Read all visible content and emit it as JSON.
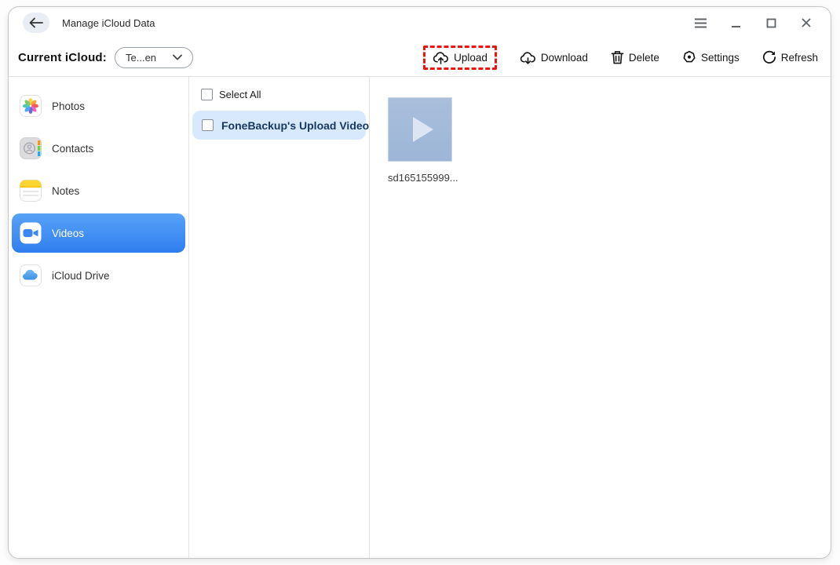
{
  "titlebar": {
    "title": "Manage iCloud Data",
    "icons": {
      "back": "back-arrow-icon",
      "menu": "hamburger-menu-icon",
      "minimize": "minimize-icon",
      "maximize": "maximize-icon",
      "close": "close-icon"
    }
  },
  "toolbar": {
    "current_icloud_label": "Current iCloud:",
    "account_dropdown": {
      "value": "Te...en",
      "icon": "chevron-down-icon"
    },
    "actions": [
      {
        "label": "Upload",
        "icon": "cloud-upload-icon",
        "highlighted": true
      },
      {
        "label": "Download",
        "icon": "cloud-download-icon",
        "highlighted": false
      },
      {
        "label": "Delete",
        "icon": "trash-icon",
        "highlighted": false
      },
      {
        "label": "Settings",
        "icon": "gear-icon",
        "highlighted": false
      },
      {
        "label": "Refresh",
        "icon": "refresh-icon",
        "highlighted": false
      }
    ]
  },
  "sidebar": {
    "items": [
      {
        "label": "Photos",
        "icon": "photos-icon",
        "selected": false
      },
      {
        "label": "Contacts",
        "icon": "contacts-icon",
        "selected": false
      },
      {
        "label": "Notes",
        "icon": "notes-icon",
        "selected": false
      },
      {
        "label": "Videos",
        "icon": "videos-icon",
        "selected": true
      },
      {
        "label": "iCloud Drive",
        "icon": "icloud-drive-icon",
        "selected": false
      }
    ]
  },
  "album_panel": {
    "select_all_label": "Select All",
    "select_all_checked": false,
    "albums": [
      {
        "label": "FoneBackup's Upload Video",
        "checked": false,
        "highlighted": true
      }
    ]
  },
  "files_panel": {
    "items": [
      {
        "filename": "sd165155999...",
        "type": "video",
        "icon": "play-icon"
      }
    ]
  },
  "colors": {
    "accent_blue": "#3b87f7",
    "selected_item_gradient_top": "#58a2f7",
    "selected_item_gradient_bottom": "#2f7ef0",
    "album_highlight_bg": "#d9e9fd",
    "album_highlight_text": "#18375f",
    "upload_dashed_border": "#ea1410",
    "thumbnail_bg": "#a3b9d8",
    "toolbar_text": "#141414",
    "divider": "#e3e3e3"
  }
}
